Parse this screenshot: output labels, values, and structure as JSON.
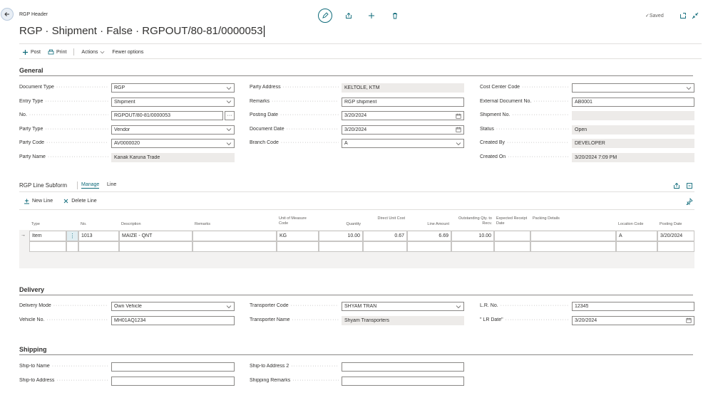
{
  "header": {
    "breadcrumb": "RGP Header",
    "title": "RGP · Shipment · False · RGPOUT/80-81/0000053",
    "saved": "Saved"
  },
  "actions": {
    "post": "Post",
    "print": "Print",
    "actions": "Actions",
    "fewer": "Fewer options"
  },
  "general": {
    "title": "General",
    "col1": [
      {
        "label": "Document Type",
        "value": "RGP",
        "type": "dropdown"
      },
      {
        "label": "Entry Type",
        "value": "Shipment",
        "type": "dropdown"
      },
      {
        "label": "No.",
        "value": "RGPOUT/80-81/0000053",
        "type": "assist"
      },
      {
        "label": "Party Type",
        "value": "Vendor",
        "type": "dropdown"
      },
      {
        "label": "Party Code",
        "value": "AV0000020",
        "type": "dropdown"
      },
      {
        "label": "Party Name",
        "value": "Kanak Karuna Trade",
        "type": "readonly"
      }
    ],
    "col2": [
      {
        "label": "Party Address",
        "value": "KELTOLE, KTM",
        "type": "readonly"
      },
      {
        "label": "Remarks",
        "value": "RGP shipment",
        "type": "text"
      },
      {
        "label": "Posting Date",
        "value": "3/20/2024",
        "type": "date"
      },
      {
        "label": "Document Date",
        "value": "3/20/2024",
        "type": "date"
      },
      {
        "label": "Branch Code",
        "value": "A",
        "type": "dropdown"
      }
    ],
    "col3": [
      {
        "label": "Cost Center Code",
        "value": "",
        "type": "dropdown"
      },
      {
        "label": "External Document No.",
        "value": "AB0001",
        "type": "text"
      },
      {
        "label": "Shipment No.",
        "value": "",
        "type": "readonly"
      },
      {
        "label": "Status",
        "value": "Open",
        "type": "readonly"
      },
      {
        "label": "Created By",
        "value": "DEVELOPER",
        "type": "readonly"
      },
      {
        "label": "Created On",
        "value": "3/20/2024 7:09 PM",
        "type": "readonly"
      }
    ]
  },
  "subform": {
    "title": "RGP Line Subform",
    "tabs": [
      "Manage",
      "Line"
    ],
    "new_line": "New Line",
    "delete_line": "Delete Line",
    "columns": [
      "Type",
      "No.",
      "Description",
      "Remarks",
      "Unit of Measure Code",
      "Quantity",
      "Direct Unit Cost",
      "Line Amount",
      "Outstanding Qty. to Recv.",
      "Expected Receipt Date",
      "Packing Details",
      "Location Code",
      "Posting Date"
    ],
    "rows": [
      {
        "type": "Item",
        "no": "1013",
        "description": "MAIZE - QNT",
        "remarks": "",
        "uom": "KG",
        "quantity": "10.00",
        "unit_cost": "0.67",
        "line_amount": "6.69",
        "outstanding": "10.00",
        "expected": "",
        "packing": "",
        "location": "A",
        "posting": "3/20/2024"
      }
    ]
  },
  "delivery": {
    "title": "Delivery",
    "col1": [
      {
        "label": "Delivery Mode",
        "value": "Own Vehicle",
        "type": "dropdown"
      },
      {
        "label": "Vehicle No.",
        "value": "MH01AQ1234",
        "type": "text"
      }
    ],
    "col2": [
      {
        "label": "Transporter Code",
        "value": "SHYAM TRAN",
        "type": "dropdown"
      },
      {
        "label": "Transporter Name",
        "value": "Shyam Transporters",
        "type": "readonly"
      }
    ],
    "col3": [
      {
        "label": "L.R. No.",
        "value": "12345",
        "type": "text"
      },
      {
        "label": "\" LR Date\"",
        "value": "3/20/2024",
        "type": "date"
      }
    ]
  },
  "shipping": {
    "title": "Shipping",
    "col1": [
      {
        "label": "Ship-to Name",
        "value": "",
        "type": "text"
      },
      {
        "label": "Ship-to Address",
        "value": "",
        "type": "text"
      }
    ],
    "col2": [
      {
        "label": "Ship-to Address 2",
        "value": "",
        "type": "text"
      },
      {
        "label": "Shipping Remarks",
        "value": "",
        "type": "text"
      }
    ]
  },
  "colors": {
    "accent": "#0f6b7a",
    "readonly": "#edebe9",
    "border": "#8a8886"
  }
}
